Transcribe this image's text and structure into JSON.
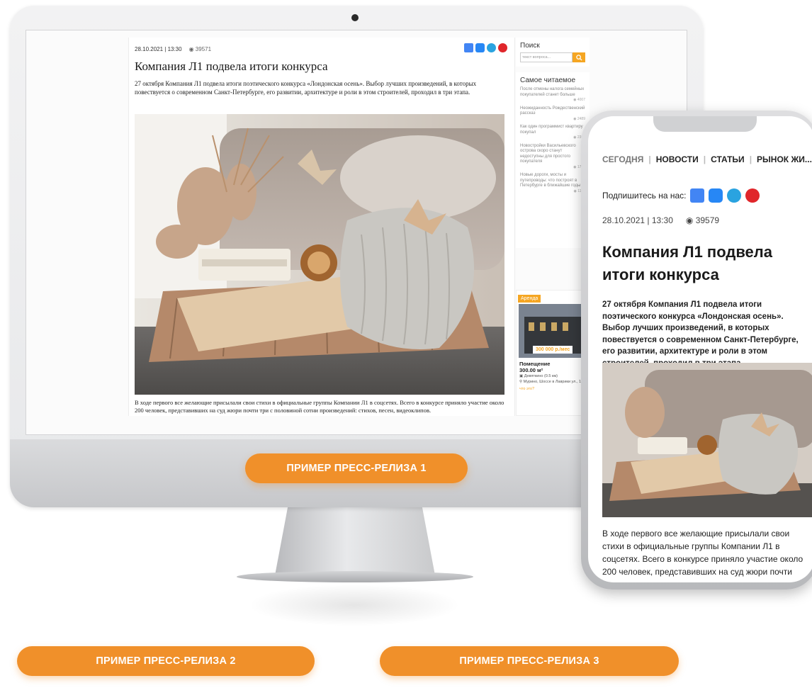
{
  "desktop": {
    "meta": {
      "date": "28.10.2021 | 13:30",
      "views": "39571"
    },
    "title": "Компания Л1 подвела итоги конкурса",
    "lead": "27 октября Компания Л1 подвела итоги поэтического конкурса «Лондонская осень». Выбор лучших произведений, в которых повествуется о современном Санкт-Петербурге, его развитии, архитектуре и роли в этом строителей, проходил в три этапа.",
    "body": "В ходе первого все желающие присылали свои стихи в официальные группы Компании Л1 в соцсетях. Всего в конкурсе приняло участие около 200 человек, представивших на суд жюри почти три с половиной сотни произведений: стихов, песен, видеоклипов.",
    "sidebar": {
      "search_title": "Поиск",
      "search_placeholder": "текст вопроса...",
      "popular_title": "Самое читаемое",
      "popular": [
        {
          "text": "После отмены налога семейных покупателей станет больше",
          "views": "4007"
        },
        {
          "text": "Неожиданность Рождественский рассказ",
          "views": "2489"
        },
        {
          "text": "Как один программист квартиру покупал",
          "views": "2391"
        },
        {
          "text": "Новостройки Васильевского острова скоро станут недоступны для простого покупателя",
          "views": "1729"
        },
        {
          "text": "Новые дороги, мосты и путепроводы: что построят в Петербурге в ближайшие годы",
          "views": "1177"
        }
      ],
      "ad": {
        "tag": "Аренда",
        "price": "300 000 р./мес",
        "name": "Помещение",
        "area": "300.00 м²",
        "metro": "Девяткино (0.5 км)",
        "address": "Мурино, Шоссе в Лаврики ул., 14А",
        "link": "что это?"
      }
    }
  },
  "phone": {
    "nav": [
      "СЕГОДНЯ",
      "НОВОСТИ",
      "СТАТЬИ",
      "РЫНОК ЖИ..."
    ],
    "subscribe": "Подпишитесь на нас:",
    "date": "28.10.2021 | 13:30",
    "views": "39579",
    "title": "Компания Л1 подвела итоги конкурса",
    "lead": "27 октября Компания Л1 подвела итоги поэтического конкурса «Лондонская осень». Выбор лучших произведений, в которых повествуется о современном Санкт-Петербурге, его развитии, архитектуре и роли в этом строителей, проходил в три этапа.",
    "body": "В ходе первого все желающие присылали свои стихи в официальные группы Компании Л1 в соцсетях. Всего в конкурсе приняло участие около 200 человек, представивших на суд жюри почти"
  },
  "buttons": {
    "release1": "ПРИМЕР ПРЕСС-РЕЛИЗА 1",
    "release2": "ПРИМЕР ПРЕСС-РЕЛИЗА 2",
    "release3": "ПРИМЕР ПРЕСС-РЕЛИЗА 3"
  },
  "colors": {
    "accent": "#f0902a",
    "vk": "#2787f5",
    "telegram": "#2aa3e0",
    "zen": "#e0262b",
    "gnews": "#4285f4"
  }
}
